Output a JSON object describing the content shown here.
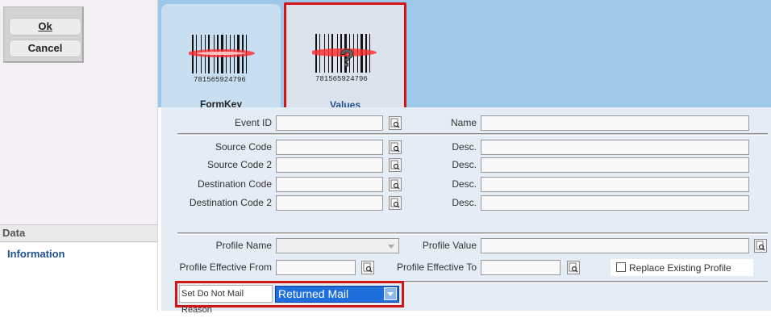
{
  "toolbar": {
    "ok_label": "Ok",
    "cancel_label": "Cancel"
  },
  "sidebar": {
    "section_header": "Data",
    "items": [
      {
        "label": "Information"
      }
    ]
  },
  "tabs": [
    {
      "label": "FormKey",
      "icon": "barcode-icon"
    },
    {
      "label": "Values",
      "icon": "barcode-question-icon"
    }
  ],
  "barcode_digits": "781565924796",
  "form": {
    "event_id": {
      "label": "Event ID",
      "value": ""
    },
    "name": {
      "label": "Name",
      "value": ""
    },
    "source_code": {
      "label": "Source Code",
      "value": ""
    },
    "source_code_desc": {
      "label": "Desc.",
      "value": ""
    },
    "source_code_2": {
      "label": "Source Code 2",
      "value": ""
    },
    "source_code_2_desc": {
      "label": "Desc.",
      "value": ""
    },
    "destination_code": {
      "label": "Destination Code",
      "value": ""
    },
    "destination_code_desc": {
      "label": "Desc.",
      "value": ""
    },
    "destination_code_2": {
      "label": "Destination Code 2",
      "value": ""
    },
    "destination_code_2_desc": {
      "label": "Desc.",
      "value": ""
    },
    "profile_name": {
      "label": "Profile Name",
      "value": ""
    },
    "profile_value": {
      "label": "Profile Value",
      "value": ""
    },
    "profile_effective_from": {
      "label": "Profile Effective From",
      "value": ""
    },
    "profile_effective_to": {
      "label": "Profile Effective To",
      "value": ""
    },
    "replace_existing_profile": {
      "label": "Replace Existing Profile",
      "checked": false
    },
    "do_not_mail_reason": {
      "label": "Set Do Not Mail Reason",
      "value": "Returned Mail"
    }
  },
  "colors": {
    "accent_red": "#d41515",
    "header_blue": "#9ec8ea",
    "form_bg": "#e4ecf5",
    "select_blue": "#1e6fdc",
    "link_blue": "#1f4f8f"
  }
}
